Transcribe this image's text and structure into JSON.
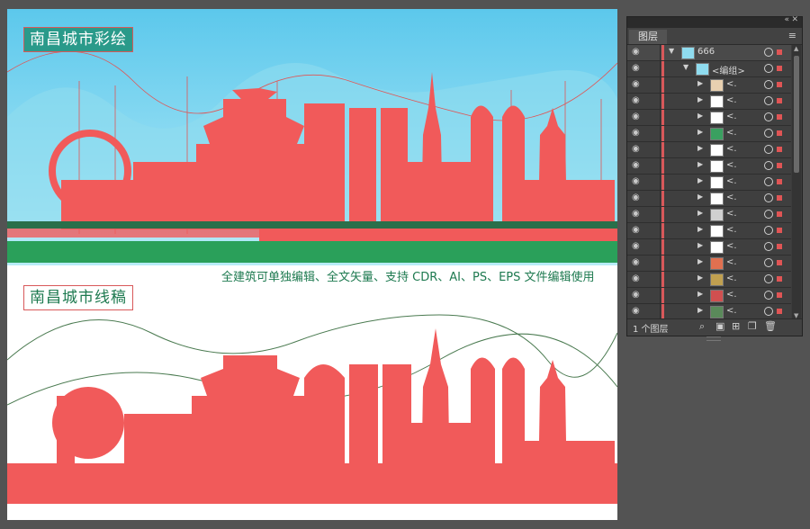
{
  "artboard": {
    "color_title": "南昌城市彩绘",
    "line_title": "南昌城市线稿",
    "caption": "全建筑可单独编辑、全文矢量、支持 CDR、AI、PS、EPS 文件编辑使用"
  },
  "colors": {
    "app_background": "#535353",
    "sky": "#5cc8ec",
    "selection": "#e05555",
    "ground_green": "#2aa05a",
    "title_teal": "#2a9a8a",
    "panel_bg": "#3c3c3c"
  },
  "layers_panel": {
    "tab_label": "图层",
    "layer_name": "666",
    "group_name": "<编组>",
    "item_label": "<.",
    "item_count": 15,
    "footer_count": "1 个图层"
  }
}
